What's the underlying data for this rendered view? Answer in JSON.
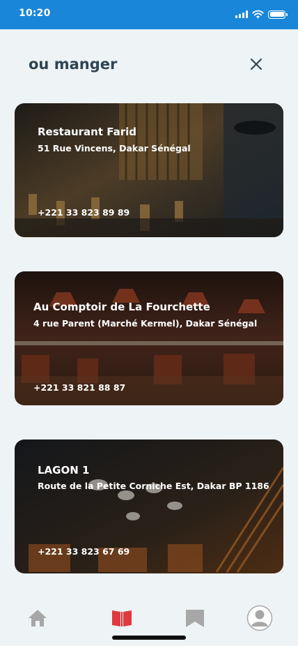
{
  "status_bar": {
    "time": "10:20",
    "icons": [
      "signal-icon",
      "wifi-icon",
      "battery-icon"
    ]
  },
  "header": {
    "title": "ou manger",
    "close_icon": "close-icon"
  },
  "restaurants": [
    {
      "name": "Restaurant Farid",
      "address": "51 Rue Vincens, Dakar Sénégal",
      "phone": "+221 33 823 89 89"
    },
    {
      "name": "Au Comptoir de La Fourchette",
      "address": "4 rue Parent (Marché Kermel), Dakar Sénégal",
      "phone": "+221 33 821 88 87"
    },
    {
      "name": "LAGON 1",
      "address": "Route de la Petite Corniche Est, Dakar BP 1186",
      "phone": "+221 33 823 67 69"
    }
  ],
  "tab_bar": {
    "tabs": [
      {
        "name": "home",
        "icon": "home-icon",
        "active": false
      },
      {
        "name": "book",
        "icon": "book-icon",
        "active": true
      },
      {
        "name": "bookmark",
        "icon": "bookmark-icon",
        "active": false
      },
      {
        "name": "profile",
        "icon": "user-icon",
        "active": false
      }
    ],
    "active_color": "#e0393e",
    "inactive_color": "#a7a7a7"
  },
  "colors": {
    "status_bar": "#1a86d9",
    "background": "#eef3f5",
    "title": "#2f4453"
  }
}
